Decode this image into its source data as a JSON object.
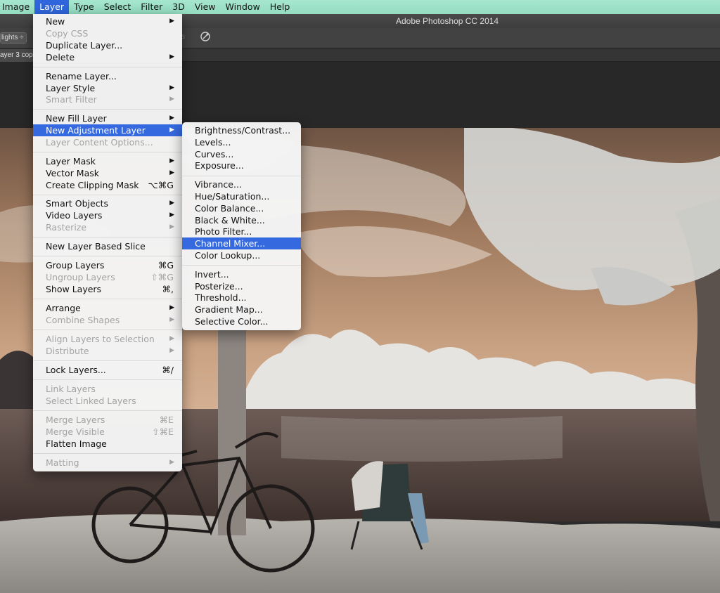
{
  "menubar": {
    "items": [
      {
        "label": "Image"
      },
      {
        "label": "Layer"
      },
      {
        "label": "Type"
      },
      {
        "label": "Select"
      },
      {
        "label": "Filter"
      },
      {
        "label": "3D"
      },
      {
        "label": "View"
      },
      {
        "label": "Window"
      },
      {
        "label": "Help"
      }
    ],
    "active": "Layer"
  },
  "app": {
    "title": "Adobe Photoshop CC 2014"
  },
  "options": {
    "dropdown_value": "lights ÷",
    "faded_label": "s"
  },
  "document": {
    "tab_label": "ayer 3 cop"
  },
  "layer_menu": {
    "new": "New",
    "copy_css": "Copy CSS",
    "duplicate_layer": "Duplicate Layer...",
    "delete": "Delete",
    "rename_layer": "Rename Layer...",
    "layer_style": "Layer Style",
    "smart_filter": "Smart Filter",
    "new_fill_layer": "New Fill Layer",
    "new_adjustment_layer": "New Adjustment Layer",
    "layer_content_options": "Layer Content Options...",
    "layer_mask": "Layer Mask",
    "vector_mask": "Vector Mask",
    "create_clipping_mask": "Create Clipping Mask",
    "create_clipping_mask_sc": "⌥⌘G",
    "smart_objects": "Smart Objects",
    "video_layers": "Video Layers",
    "rasterize": "Rasterize",
    "new_layer_based_slice": "New Layer Based Slice",
    "group_layers": "Group Layers",
    "group_layers_sc": "⌘G",
    "ungroup_layers": "Ungroup Layers",
    "ungroup_layers_sc": "⇧⌘G",
    "show_layers": "Show Layers",
    "show_layers_sc": "⌘,",
    "arrange": "Arrange",
    "combine_shapes": "Combine Shapes",
    "align_layers_to_selection": "Align Layers to Selection",
    "distribute": "Distribute",
    "lock_layers": "Lock Layers...",
    "lock_layers_sc": "⌘/",
    "link_layers": "Link Layers",
    "select_linked_layers": "Select Linked Layers",
    "merge_layers": "Merge Layers",
    "merge_layers_sc": "⌘E",
    "merge_visible": "Merge Visible",
    "merge_visible_sc": "⇧⌘E",
    "flatten_image": "Flatten Image",
    "matting": "Matting",
    "arrow": "▶"
  },
  "adjustment_menu": {
    "brightness_contrast": "Brightness/Contrast...",
    "levels": "Levels...",
    "curves": "Curves...",
    "exposure": "Exposure...",
    "vibrance": "Vibrance...",
    "hue_saturation": "Hue/Saturation...",
    "color_balance": "Color Balance...",
    "black_white": "Black & White...",
    "photo_filter": "Photo Filter...",
    "channel_mixer": "Channel Mixer...",
    "color_lookup": "Color Lookup...",
    "invert": "Invert...",
    "posterize": "Posterize...",
    "threshold": "Threshold...",
    "gradient_map": "Gradient Map...",
    "selective_color": "Selective Color..."
  },
  "colors": {
    "menubar_bg": "#a6e6cf",
    "highlight": "#3569df",
    "sky_warm": "#b89070",
    "water": "#5a4a45"
  }
}
